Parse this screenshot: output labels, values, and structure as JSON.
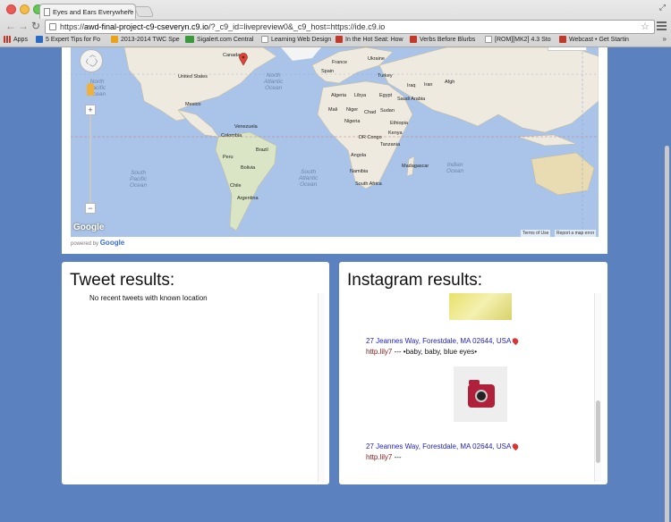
{
  "browser": {
    "tab_title": "Eyes and Ears Everywhere",
    "url_prefix": "https://",
    "url_host": "awd-final-project-c9-cseveryn.c9.io",
    "url_rest": "/?_c9_id=livepreview0&_c9_host=https://ide.c9.io",
    "bookmarks": [
      {
        "label": "Apps",
        "color": "#c0392b"
      },
      {
        "label": "5 Expert Tips for Fo",
        "color": "#2d6ac4"
      },
      {
        "label": "2013-2014 TWC Spe",
        "color": "#e8a317"
      },
      {
        "label": "Sigalert.com Central",
        "color": "#3a9a3a"
      },
      {
        "label": "Learning Web Design",
        "color": "#dddddd"
      },
      {
        "label": "In the Hot Seat: How",
        "color": "#c0392b"
      },
      {
        "label": "Verbs Before Blurbs",
        "color": "#c0392b"
      },
      {
        "label": "[ROM][MK2] 4.3 Sto",
        "color": "#dddddd"
      },
      {
        "label": "Webcast • Get Startin",
        "color": "#c0392b"
      }
    ],
    "bookmarks_more": "»"
  },
  "map": {
    "labels": {
      "canada": "Canada",
      "united_states": "United States",
      "mexico": "Mexico",
      "venezuela": "Venezuela",
      "colombia": "Colombia",
      "peru": "Peru",
      "brazil": "Brazil",
      "bolivia": "Bolivia",
      "chile": "Chile",
      "argentina": "Argentina",
      "france": "France",
      "spain": "Spain",
      "ukraine": "Ukraine",
      "turkey": "Turkey",
      "algeria": "Algeria",
      "libya": "Libya",
      "egypt": "Egypt",
      "mali": "Mali",
      "niger": "Niger",
      "chad": "Chad",
      "sudan": "Sudan",
      "nigeria": "Nigeria",
      "ethiopia": "Ethiopia",
      "kenya": "Kenya",
      "tanzania": "Tanzania",
      "angola": "Angola",
      "dr_congo": "DR Congo",
      "namibia": "Namibia",
      "south_africa": "South Africa",
      "madagascar": "Madagascar",
      "saudi_arabia": "Saudi Arabia",
      "iran": "Iran",
      "iraq": "Iraq",
      "afgh": "Afgh"
    },
    "oceans": {
      "north_pacific": "North\nPacific\nOcean",
      "north_atlantic": "North\nAtlantic\nOcean",
      "south_pacific": "South\nPacific\nOcean",
      "south_atlantic": "South\nAtlantic\nOcean",
      "indian": "Indian\nOcean"
    },
    "google_logo": "Google",
    "terms": "Terms of Use",
    "report": "Report a map error",
    "powered_by": "powered by",
    "powered_brand": "Google"
  },
  "tweets": {
    "title": "Tweet results:",
    "empty_message": "No recent tweets with known location"
  },
  "instagram": {
    "title": "Instagram results:",
    "posts": [
      {
        "location": "27 Jeannes Way, Forestdale, MA 02644, USA",
        "user": "http.lily7",
        "separator": " --- ",
        "caption": "•baby, baby, blue eyes•"
      },
      {
        "location": "27 Jeannes Way, Forestdale, MA 02644, USA",
        "user": "http.lily7",
        "separator": " --- ",
        "caption": ""
      }
    ]
  }
}
